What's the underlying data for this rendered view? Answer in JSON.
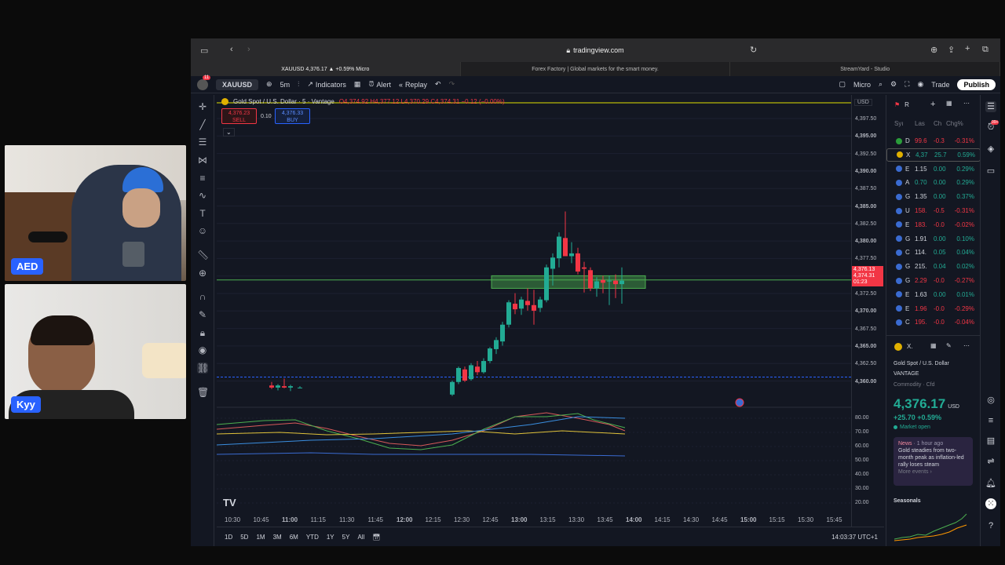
{
  "cams": [
    {
      "label": "AED"
    },
    {
      "label": "Kyy"
    }
  ],
  "browser": {
    "url": "tradingview.com",
    "tabs": [
      {
        "label": "XAUUSD 4,376.17 ▲ +0.59% Micro",
        "active": true
      },
      {
        "label": "Forex Factory | Global markets for the smart money.",
        "active": false
      },
      {
        "label": "StreamYard - Studio",
        "active": false
      }
    ]
  },
  "toolbar": {
    "badge": "11",
    "symbol": "XAUUSD",
    "interval": "5m",
    "indicators": "Indicators",
    "alert": "Alert",
    "replay": "Replay",
    "layout": "Micro",
    "trade": "Trade",
    "publish": "Publish"
  },
  "legend": {
    "title": "Gold Spot / U.S. Dollar · 5 · Vantage",
    "ohlc": "O4,374.92 H4,377.12 L4,370.29 C4,374.31 −0.12 (−0.00%)",
    "sell_price": "4,376.23",
    "sell_label": "SELL",
    "spread": "0.10",
    "buy_price": "4,376.33",
    "buy_label": "BUY"
  },
  "price_axis": {
    "currency": "USD",
    "labels": [
      "4,397.50",
      "4,395.00",
      "4,392.50",
      "4,390.00",
      "4,387.50",
      "4,385.00",
      "4,382.50",
      "4,380.00",
      "4,377.50",
      "4,375.00",
      "4,372.50",
      "4,370.00",
      "4,367.50",
      "4,365.00",
      "4,362.50",
      "4,360.00"
    ],
    "last_price": "4,376.13",
    "last_price2": "4,374.31",
    "countdown": "01:23",
    "osc_labels": [
      "80.00",
      "70.00",
      "60.00",
      "50.00",
      "40.00",
      "30.00",
      "20.00"
    ]
  },
  "time_axis": [
    "10:30",
    "10:45",
    "11:00",
    "11:15",
    "11:30",
    "11:45",
    "12:00",
    "12:15",
    "12:30",
    "12:45",
    "13:00",
    "13:15",
    "13:30",
    "13:45",
    "14:00",
    "14:15",
    "14:30",
    "14:45",
    "15:00",
    "15:15",
    "15:30",
    "15:45"
  ],
  "bottombar": {
    "ranges": [
      "1D",
      "5D",
      "1M",
      "3M",
      "6M",
      "YTD",
      "1Y",
      "5Y",
      "All"
    ],
    "clock": "14:03:37 UTC+1"
  },
  "watchlist": {
    "header": "R",
    "cols": [
      "Syı",
      "Las",
      "Ch",
      "Chg%"
    ],
    "rows": [
      {
        "s": "D",
        "l": "99.6",
        "c": "-0.3",
        "p": "-0.31%",
        "neg": true,
        "color": "#2a9d3a"
      },
      {
        "s": "X",
        "l": "4,37",
        "c": "25.7",
        "p": "0.59%",
        "neg": false,
        "color": "#e0b000"
      },
      {
        "s": "E",
        "l": "1.15",
        "c": "0.00",
        "p": "0.29%",
        "neg": false,
        "color": "#3a6bd1"
      },
      {
        "s": "A",
        "l": "0.70",
        "c": "0.00",
        "p": "0.29%",
        "neg": false,
        "color": "#3a6bd1"
      },
      {
        "s": "G",
        "l": "1.35",
        "c": "0.00",
        "p": "0.37%",
        "neg": false,
        "color": "#3a6bd1"
      },
      {
        "s": "U",
        "l": "158.",
        "c": "-0.5",
        "p": "-0.31%",
        "neg": true,
        "color": "#3a6bd1"
      },
      {
        "s": "E",
        "l": "183.",
        "c": "-0.0",
        "p": "-0.02%",
        "neg": true,
        "color": "#3a6bd1"
      },
      {
        "s": "G",
        "l": "1.91",
        "c": "0.00",
        "p": "0.10%",
        "neg": false,
        "color": "#3a6bd1"
      },
      {
        "s": "C",
        "l": "114.",
        "c": "0.05",
        "p": "0.04%",
        "neg": false,
        "color": "#3a6bd1"
      },
      {
        "s": "G",
        "l": "215.",
        "c": "0.04",
        "p": "0.02%",
        "neg": false,
        "color": "#3a6bd1"
      },
      {
        "s": "G",
        "l": "2.29",
        "c": "-0.0",
        "p": "-0.27%",
        "neg": true,
        "color": "#3a6bd1"
      },
      {
        "s": "E",
        "l": "1.63",
        "c": "0.00",
        "p": "0.01%",
        "neg": false,
        "color": "#3a6bd1"
      },
      {
        "s": "E",
        "l": "1.96",
        "c": "-0.0",
        "p": "-0.29%",
        "neg": true,
        "color": "#3a6bd1"
      },
      {
        "s": "C",
        "l": "195.",
        "c": "-0.0",
        "p": "-0.04%",
        "neg": true,
        "color": "#3a6bd1"
      }
    ]
  },
  "details": {
    "header": "X.",
    "name": "Gold Spot / U.S. Dollar",
    "exchange": "VANTAGE",
    "category": "Commodity · Cfd",
    "price": "4,376.17",
    "currency": "USD",
    "change": "+25.70 +0.59%",
    "status": "Market open",
    "news_tag": "News",
    "news_time": "· 1 hour ago",
    "news_text": "Gold steadies from two-month peak as inflation-led rally loses steam",
    "news_more": "More events ›",
    "seasonals": "Seasonals"
  },
  "badge_99": "99+",
  "colors": {
    "up": "#22ab94",
    "down": "#f23645",
    "accent": "#2962ff",
    "zone": "#4caf50"
  }
}
